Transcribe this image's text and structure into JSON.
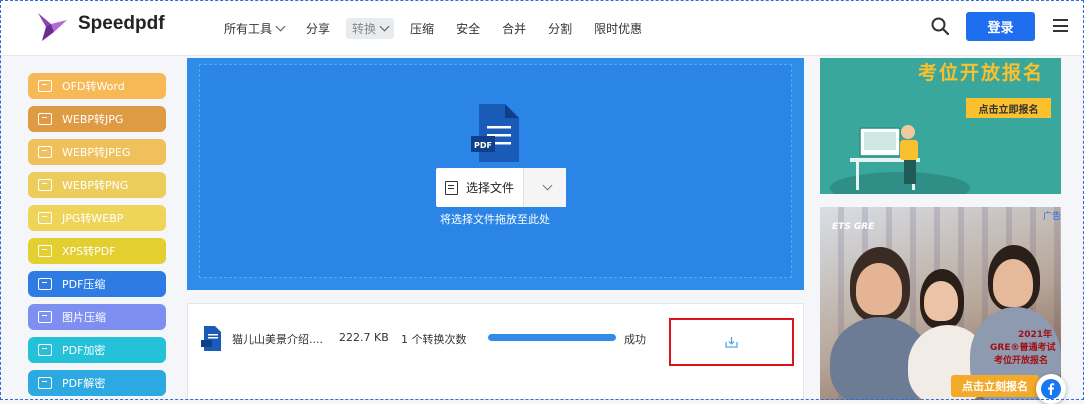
{
  "header": {
    "brand": "Speedpdf",
    "nav": [
      {
        "label": "所有工具",
        "dropdown": true
      },
      {
        "label": "分享"
      },
      {
        "label": "转换",
        "dropdown": true,
        "active": true
      },
      {
        "label": "压缩"
      },
      {
        "label": "安全"
      },
      {
        "label": "合并"
      },
      {
        "label": "分割"
      },
      {
        "label": "限时优惠"
      }
    ],
    "login_label": "登录"
  },
  "sidebar": {
    "items": [
      {
        "label": "OFD转Word",
        "color": "#f7b955"
      },
      {
        "label": "WEBP转JPG",
        "color": "#df9b44"
      },
      {
        "label": "WEBP转JPEG",
        "color": "#efc05c"
      },
      {
        "label": "WEBP转PNG",
        "color": "#eccd5c"
      },
      {
        "label": "JPG转WEBP",
        "color": "#eed55a"
      },
      {
        "label": "XPS转PDF",
        "color": "#e3cf2f"
      },
      {
        "label": "PDF压缩",
        "color": "#2f7be4"
      },
      {
        "label": "图片压缩",
        "color": "#7d8ff0"
      },
      {
        "label": "PDF加密",
        "color": "#24c1d9"
      },
      {
        "label": "PDF解密",
        "color": "#2ba9e0"
      }
    ]
  },
  "upload": {
    "file_badge": "PDF",
    "choose_label": "选择文件",
    "drop_hint": "将选择文件拖放至此处",
    "background": "#2f8de8"
  },
  "result": {
    "file_name": "猫儿山美景介绍....",
    "file_size": "222.7 KB",
    "conversions": "1 个转换次数",
    "progress": 1.0,
    "status": "成功"
  },
  "ads": {
    "ad1": {
      "title": "考位开放报名",
      "button": "点击立即报名"
    },
    "ad2": {
      "tag": "广告",
      "brand": "ETS GRE",
      "line1": "2021年",
      "line2": "GRE®普通考试",
      "line3": "考位开放报名",
      "button": "点击立刻报名"
    }
  },
  "colors": {
    "accent": "#1f6ef0",
    "highlight_border": "#d9151b"
  }
}
